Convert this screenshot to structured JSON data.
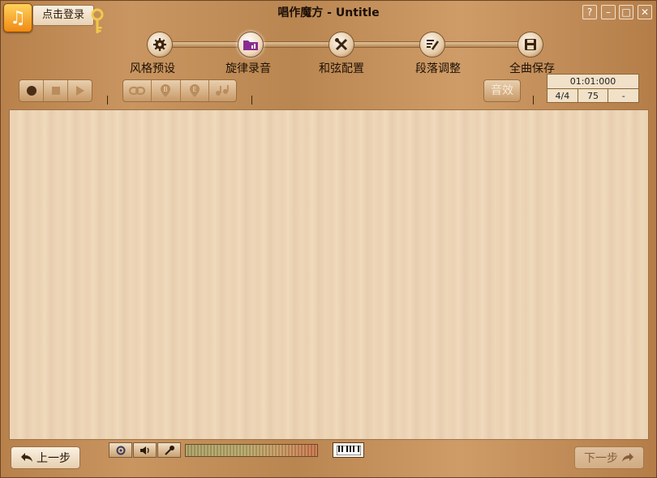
{
  "window": {
    "title": "唱作魔方 - Untitle",
    "login_label": "点击登录",
    "controls": [
      "?",
      "–",
      "□",
      "✕"
    ]
  },
  "steps": [
    {
      "label": "风格预设",
      "icon": "gear-icon",
      "active": false
    },
    {
      "label": "旋律录音",
      "icon": "folder-music-icon",
      "active": true
    },
    {
      "label": "和弦配置",
      "icon": "tools-icon",
      "active": false
    },
    {
      "label": "段落调整",
      "icon": "edit-list-icon",
      "active": false
    },
    {
      "label": "全曲保存",
      "icon": "save-icon",
      "active": false
    }
  ],
  "transport": [
    "record-icon",
    "stop-icon",
    "play-icon"
  ],
  "tools": [
    "link-icon",
    "b-pin-icon",
    "e-pin-icon",
    "notes-icon"
  ],
  "effect_label": "音效",
  "info": {
    "time": "01:01:000",
    "meter": "4/4",
    "tempo": "75",
    "key": "-"
  },
  "bottom": {
    "prev_label": "上一步",
    "next_label": "下一步",
    "level_meter_percent": 100
  },
  "colors": {
    "accent_orange": "#f08a13",
    "active_step_purple": "#8a2c8f",
    "wood_dark": "#b47d48",
    "panel": "#edd5b7"
  }
}
